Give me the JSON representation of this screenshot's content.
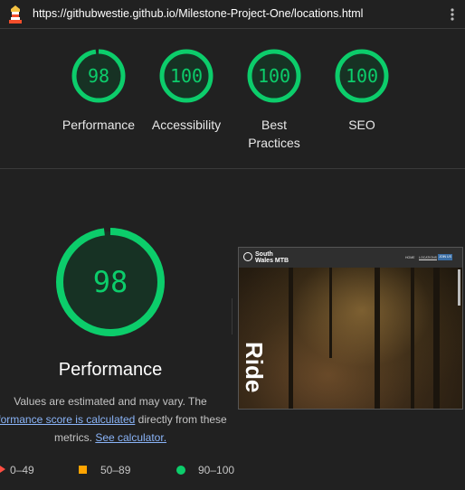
{
  "header": {
    "url": "https://githubwestie.github.io/Milestone-Project-One/locations.html"
  },
  "scores": [
    {
      "label": "Performance",
      "value": "98",
      "fraction": 0.98
    },
    {
      "label": "Accessibility",
      "value": "100",
      "fraction": 1.0
    },
    {
      "label": "Best\nPractices",
      "value": "100",
      "fraction": 1.0
    },
    {
      "label": "SEO",
      "value": "100",
      "fraction": 1.0
    }
  ],
  "detail": {
    "score": "98",
    "fraction": 0.98,
    "title": "Performance",
    "note_line1": "Values are estimated and may vary. The",
    "note_link1": "rformance score is calculated",
    "note_line2_suffix": " directly from these",
    "note_line3_prefix": "metrics. ",
    "note_link2": "See calculator."
  },
  "screenshot": {
    "brand_line1": "South",
    "brand_line2": "Wales MTB",
    "nav_links": [
      "HOME",
      "LOCATIONS"
    ],
    "nav_button": "JOIN US",
    "hero_text": "Ride"
  },
  "legend": [
    {
      "range": "0–49",
      "color": "#ff4e42"
    },
    {
      "range": "50–89",
      "color": "#ffa400"
    },
    {
      "range": "90–100",
      "color": "#0ccd6b"
    }
  ],
  "colors": {
    "pass": "#0ccd6b",
    "pass_bg": "#173224",
    "background": "#212121"
  }
}
